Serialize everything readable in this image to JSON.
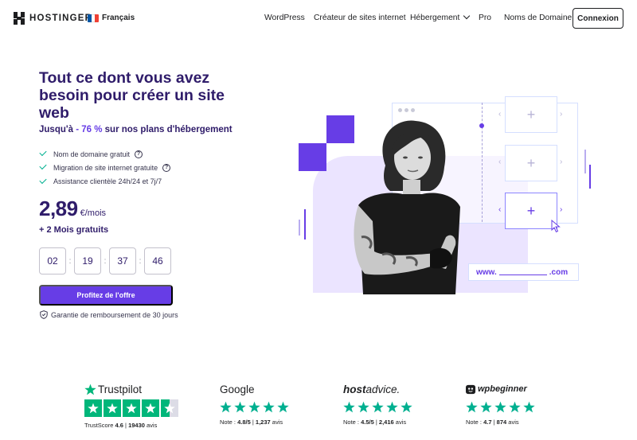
{
  "nav": {
    "brand": "HOSTINGER",
    "language": "Français",
    "links": [
      {
        "label": "WordPress"
      },
      {
        "label": "Créateur de sites internet"
      },
      {
        "label": "Hébergement"
      },
      {
        "label": "Pro"
      },
      {
        "label": "Noms de Domaine"
      }
    ],
    "login_label": "Connexion",
    "flag_colors": [
      "#0055a4",
      "#ffffff",
      "#ef4135"
    ]
  },
  "hero": {
    "title": "Tout ce dont vous avez besoin pour créer un site web",
    "subtitle_prefix": "Jusqu'à",
    "subtitle_accent": "- 76 %",
    "subtitle_suffix": "sur nos plans d'hébergement",
    "features": [
      {
        "label": "Nom de domaine gratuit",
        "info": true
      },
      {
        "label": "Migration de site internet gratuite",
        "info": true
      },
      {
        "label": "Assistance clientèle 24h/24 et 7j/7",
        "info": false
      }
    ],
    "price": "2,89",
    "price_unit": "€/mois",
    "bonus": "+ 2 Mois gratuits",
    "countdown": [
      "02",
      "19",
      "37",
      "46"
    ],
    "countdown_sep": ":",
    "cta_label": "Profitez de l'offre",
    "guarantee": "Garantie de remboursement de 30 jours",
    "url_prefix": "www.",
    "url_suffix": ".com",
    "accent_color": "#673de6"
  },
  "ratings": [
    {
      "brand": "Trustpilot",
      "score_label": "TrustScore",
      "score": "4.6",
      "reviews": "19430",
      "reviews_suffix": "avis",
      "stars": 4.5
    },
    {
      "brand": "Google",
      "note_label": "Note :",
      "score": "4.8/5",
      "reviews": "1,237",
      "reviews_suffix": "avis",
      "stars": 5
    },
    {
      "brand_host": "host",
      "brand_advice": "advice.",
      "note_label": "Note :",
      "score": "4.5/5",
      "reviews": "2,416",
      "reviews_suffix": "avis",
      "stars": 5
    },
    {
      "brand": "wpbeginner",
      "note_label": "Note :",
      "score": "4.7",
      "reviews": "874",
      "reviews_suffix": "avis",
      "stars": 5
    }
  ]
}
